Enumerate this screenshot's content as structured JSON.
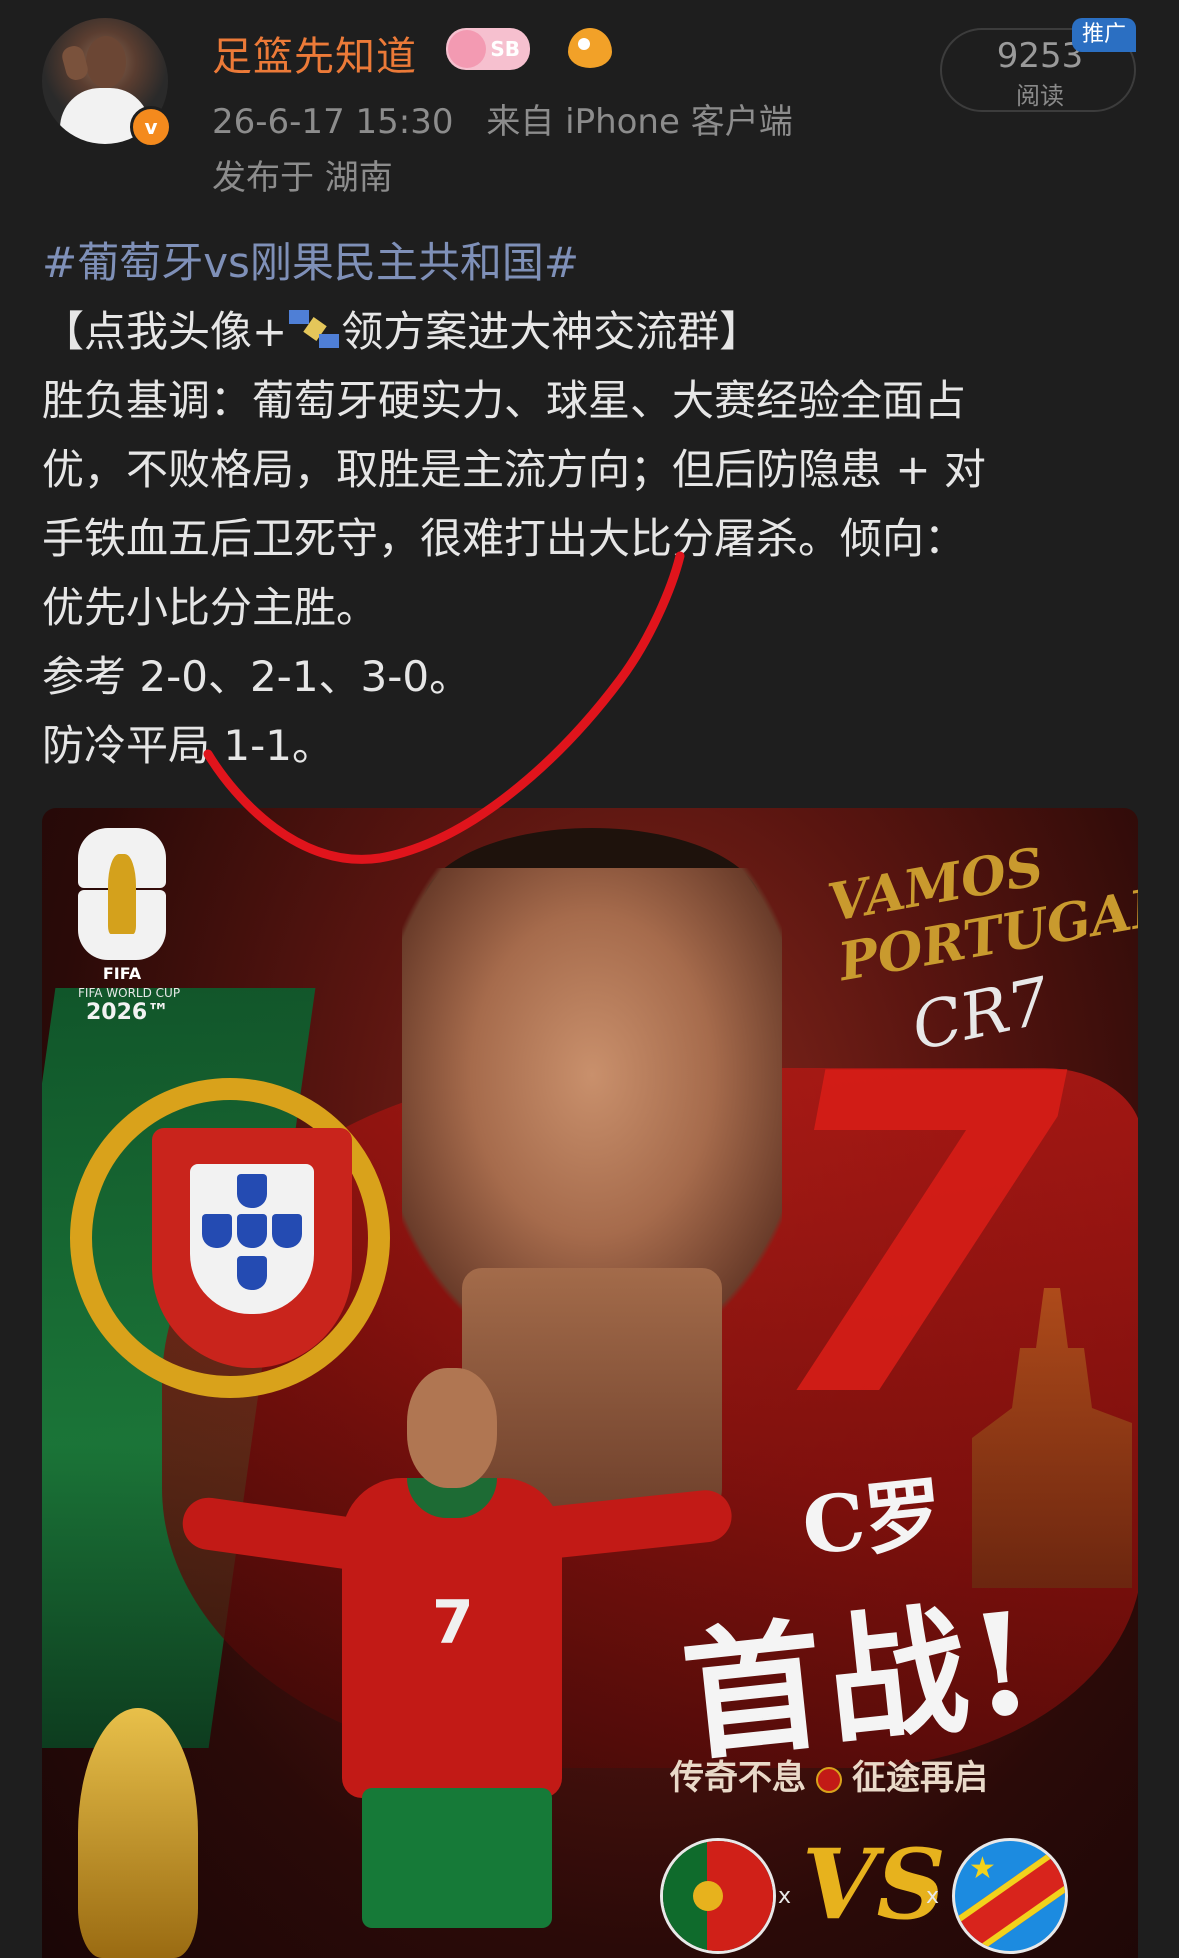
{
  "post": {
    "username": "足篮先知道",
    "badge_text": "SB",
    "timestamp": "26-6-17 15:30",
    "source": "来自 iPhone 客户端",
    "location": "发布于 湖南",
    "read_count": "9253",
    "read_label": "阅读",
    "promo_tag": "推广",
    "verified_mark": "v"
  },
  "content": {
    "hashtag": "#葡萄牙vs刚果民主共和国#",
    "cta_prefix": "【点我头像+",
    "cta_suffix": "领方案进大神交流群】",
    "lines": [
      "胜负基调：葡萄牙硬实力、球星、大赛经验全面占",
      "优，不败格局，取胜是主流方向；但后防隐患 + 对",
      "手铁血五后卫死守，很难打出大比分屠杀。倾向：",
      "优先小比分主胜。",
      "参考 2-0、2-1、3-0。",
      "防冷平局 1-1。"
    ]
  },
  "poster": {
    "fifa_word": "FIFA",
    "fifa_line": "FIFA WORLD CUP",
    "fifa_year": "2026™",
    "vamos": "VAMOS PORTUGAL!",
    "signature": "CR7",
    "big_number": "7",
    "jersey_number": "7",
    "headline_a": "C罗",
    "headline_b": "首战!",
    "sub_left": "传奇不息",
    "sub_right": "征途再启",
    "vs": "VS",
    "x": "x"
  },
  "colors": {
    "background": "#1e1e1e",
    "username": "#ec7a38",
    "hashtag": "#7f90b8",
    "meta": "#8c8c8c",
    "promo": "#2b6fc2",
    "annotation_stroke": "#e0141c"
  }
}
